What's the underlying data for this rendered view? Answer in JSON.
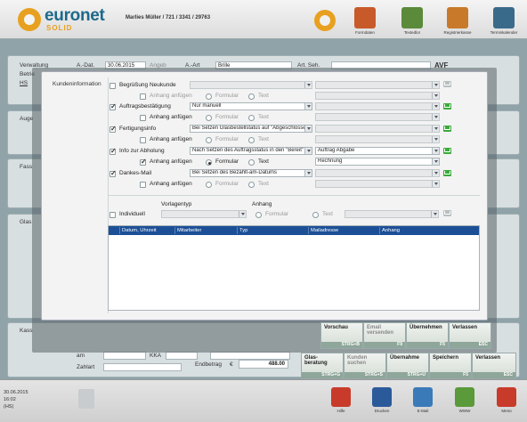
{
  "header": {
    "brand": "euronet",
    "brand_sub": "SOLID",
    "user": "Marlies Müller / 721 / 3341 / 29763",
    "tiles": [
      {
        "label": "Formdaten",
        "icon": "glasses-icon",
        "color": "#c85a2a"
      },
      {
        "label": "Textedlor",
        "icon": "pencil-icon",
        "color": "#5a8a3a"
      },
      {
        "label": "Registrierkasse",
        "icon": "cash-register-icon",
        "color": "#c87a2a"
      },
      {
        "label": "Terminkalender",
        "icon": "calendar-icon",
        "color": "#3a6a8a"
      }
    ]
  },
  "background": {
    "verwaltung": "Verwaltung",
    "betrieb": "Betrie",
    "hs": "HS",
    "a_dat_label": "A.-Dat.",
    "a_dat_value": "30.06.2015",
    "angeb": "Angeb",
    "a_art_label": "A.-Art",
    "a_art_value": "Brille",
    "art_seh_label": "Art. Seh.",
    "avf": "AVF",
    "auge": "Auge",
    "fass": "Fass",
    "glas": "Glas",
    "kass": "Kass",
    "am": "am",
    "kka": "KKA",
    "zahlart": "Zahlart",
    "endbetrag_label": "Endbetrag",
    "currency": "€",
    "endbetrag_value": "488.00"
  },
  "dialog": {
    "side_label": "Kundeninformation",
    "rows": [
      {
        "label": "Begrüßung Neukunde",
        "checked": false,
        "select": "",
        "attach_checked": false,
        "radio": "none",
        "extra": "",
        "mail_active": false
      },
      {
        "label": "Auftragsbestätigung",
        "checked": true,
        "select": "Nur manuell",
        "attach_checked": false,
        "radio": "none",
        "extra": "",
        "mail_active": true
      },
      {
        "label": "Fertigungsinfo",
        "checked": true,
        "select": "Bei Setzen Glasbestellstatus auf \"Abgeschlossen\"",
        "attach_checked": false,
        "radio": "none",
        "extra": "",
        "mail_active": true
      },
      {
        "label": "Info zur Abholung",
        "checked": true,
        "select": "Nach Setzen des Auftragsstatus in den \"Bereit\"",
        "attach_checked": true,
        "radio": "formular",
        "extra": "Auftrag Abgabe",
        "extra2": "Rechnung",
        "mail_active": true
      },
      {
        "label": "Dankes-Mail",
        "checked": true,
        "select": "Bei Setzen des Bezahlt-am-Datums",
        "attach_checked": false,
        "radio": "none",
        "extra": "",
        "mail_active": true
      }
    ],
    "attach_label": "Anhang anfügen",
    "formular_label": "Formular",
    "text_label": "Text",
    "individuell_label": "Individuell",
    "vorlagentyp_label": "Vorlagentyp",
    "anhang_label": "Anhang",
    "table_headers": [
      "Datum, Uhrzeit",
      "Mitarbeiter",
      "Typ",
      "Mailadresse",
      "Anhang"
    ],
    "buttons": [
      {
        "label": "Vorschau",
        "key": "STRG+B",
        "enabled": true
      },
      {
        "label": "Email versenden",
        "key": "F9",
        "enabled": false
      },
      {
        "label": "Übernehmen",
        "key": "F5",
        "enabled": true
      },
      {
        "label": "Verlassen",
        "key": "ESC",
        "enabled": true
      }
    ],
    "buttons_row2": [
      {
        "label": "Glas-beratung",
        "key": "STRG+G"
      },
      {
        "label": "Kunden suchen",
        "key": "STRG+S"
      },
      {
        "label": "Übernahme",
        "key": "STRG+U"
      },
      {
        "label": "Speichern",
        "key": "F5"
      },
      {
        "label": "Verlassen",
        "key": "ESC"
      }
    ]
  },
  "footer": {
    "date": "30.06.2015",
    "time": "16:02",
    "hs": "(HS)",
    "tiles": [
      {
        "label": "Hilfe",
        "icon": "help-icon",
        "color": "#c83a2a"
      },
      {
        "label": "Drucken",
        "icon": "printer-icon",
        "color": "#2a5a9a"
      },
      {
        "label": "E-Mail",
        "icon": "email-icon",
        "color": "#3a7ab8"
      },
      {
        "label": "WWW",
        "icon": "globe-icon",
        "color": "#5a9a3a"
      },
      {
        "label": "Menü",
        "icon": "menu-icon",
        "color": "#c83a2a"
      }
    ]
  }
}
